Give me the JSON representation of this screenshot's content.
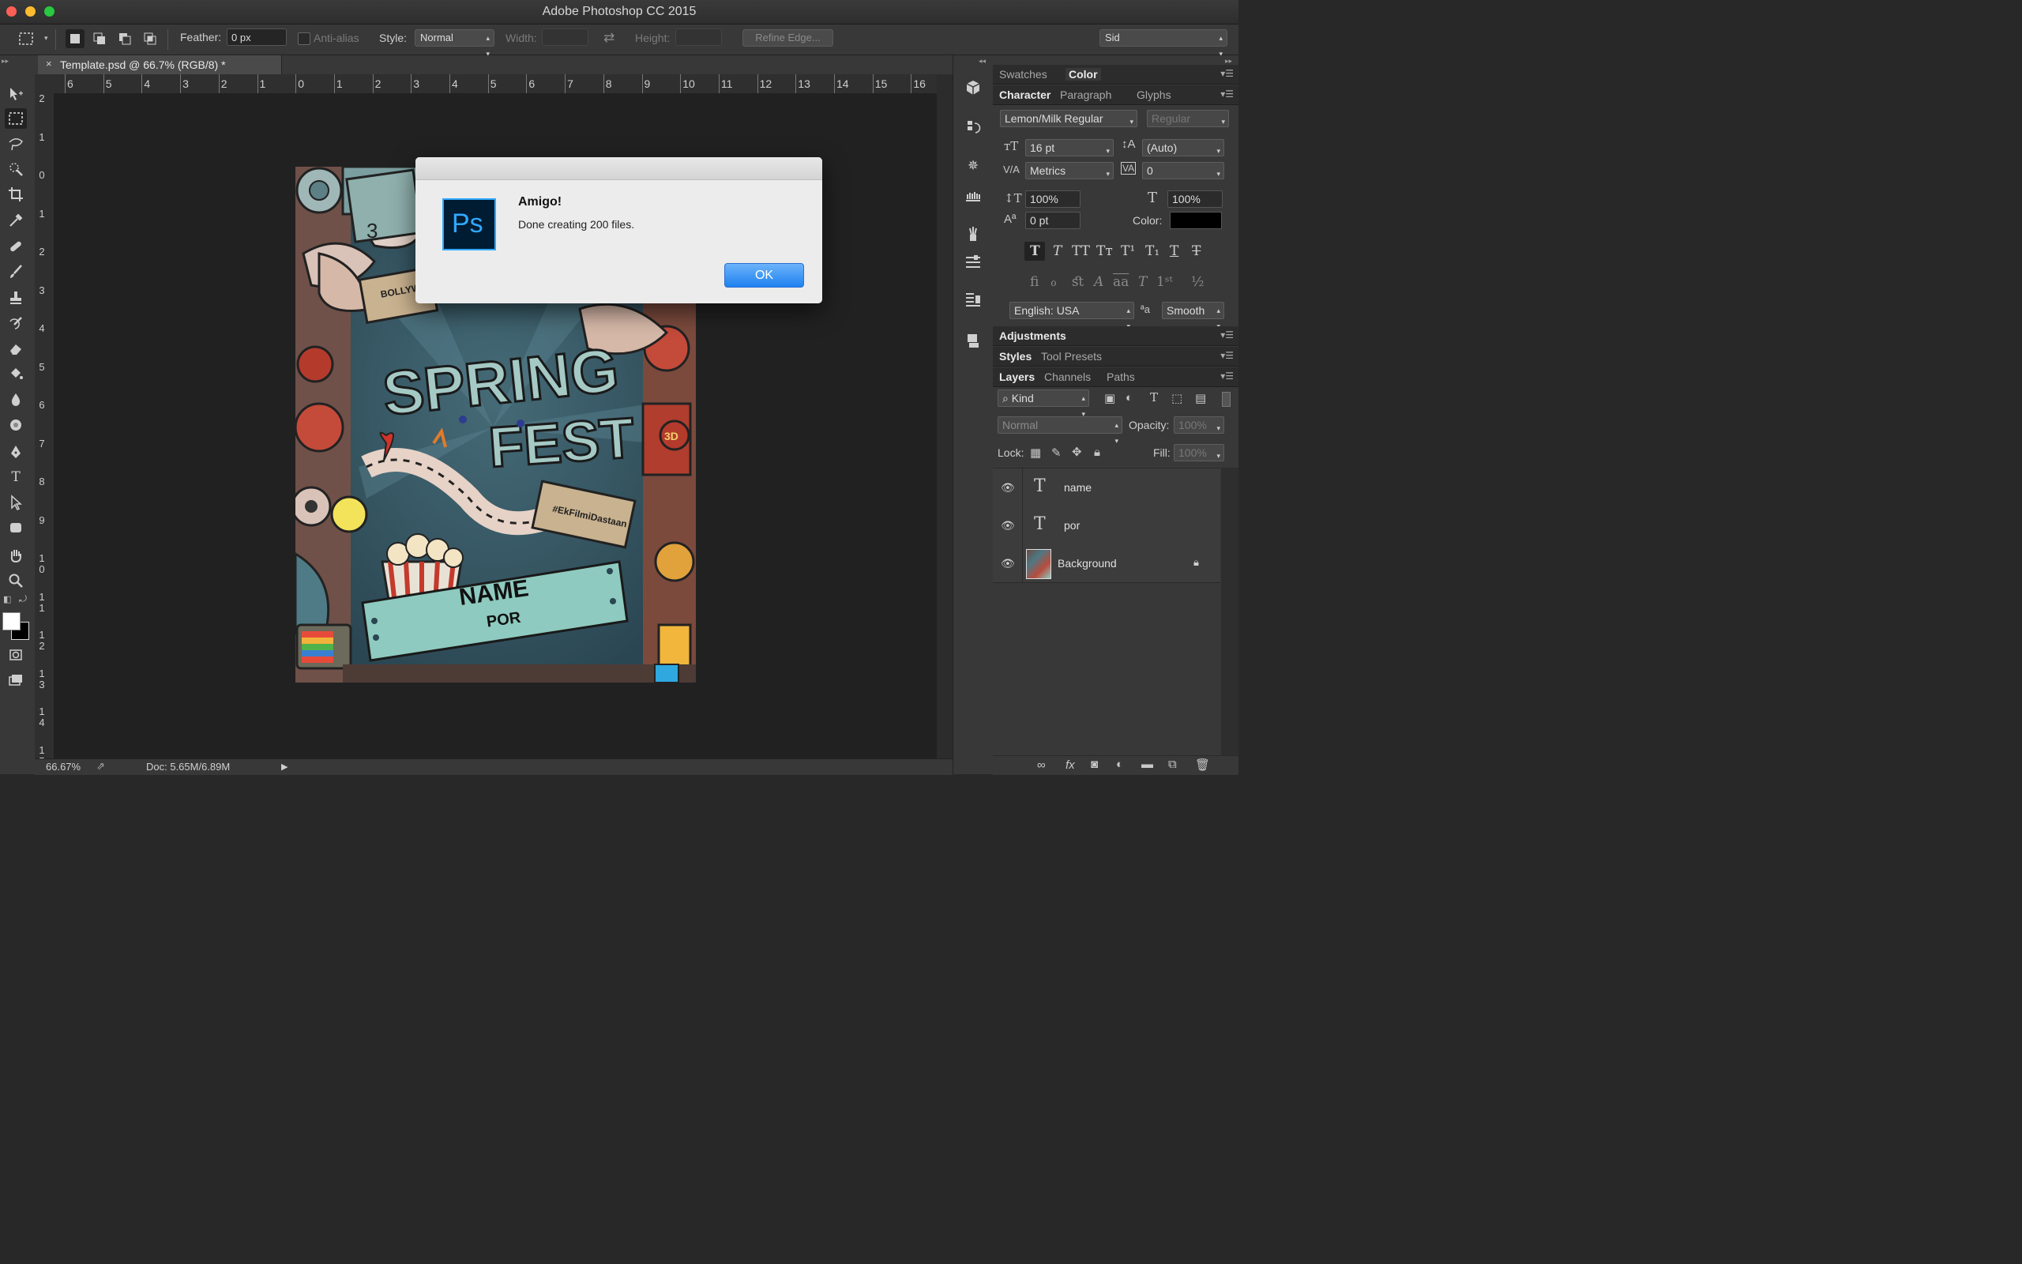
{
  "window": {
    "title": "Adobe Photoshop CC 2015"
  },
  "options": {
    "feather_label": "Feather:",
    "feather_value": "0 px",
    "antialias_label": "Anti-alias",
    "style_label": "Style:",
    "style_value": "Normal",
    "width_label": "Width:",
    "height_label": "Height:",
    "refine_edge": "Refine Edge...",
    "workspace": "Sid"
  },
  "document": {
    "tab_title": "Template.psd @ 66.7% (RGB/8) *",
    "zoom": "66.67%",
    "doc_size": "Doc: 5.65M/6.89M"
  },
  "rulers": {
    "horizontal": [
      "6",
      "5",
      "4",
      "3",
      "2",
      "1",
      "0",
      "1",
      "2",
      "3",
      "4",
      "5",
      "6",
      "7",
      "8",
      "9",
      "10",
      "11",
      "12",
      "13",
      "14",
      "15",
      "16"
    ],
    "vertical": [
      "2",
      "1",
      "0",
      "1",
      "2",
      "3",
      "4",
      "5",
      "6",
      "7",
      "8",
      "9",
      "10",
      "11",
      "12",
      "13",
      "14",
      "15"
    ]
  },
  "poster": {
    "title1": "SPRING",
    "title2": "FEST",
    "name_text": "NAME",
    "por_text": "POR",
    "ticket1": "BOLLYW BOULE",
    "ticket2": "#EkFilmiDastaan",
    "badge": "3D"
  },
  "dialog": {
    "app_icon_text": "Ps",
    "heading": "Amigo!",
    "message": "Done creating 200 files.",
    "ok_label": "OK"
  },
  "panels": {
    "color_tabs": [
      "Swatches",
      "Color"
    ],
    "char_tabs": [
      "Character",
      "Paragraph",
      "Glyphs"
    ],
    "font_family": "Lemon/Milk Regular",
    "font_style": "Regular",
    "font_size": "16 pt",
    "leading": "(Auto)",
    "kerning": "Metrics",
    "tracking": "0",
    "vertical_scale": "100%",
    "horizontal_scale": "100%",
    "baseline_shift": "0 pt",
    "color_label": "Color:",
    "text_color": "#000000",
    "language": "English: USA",
    "antialias": "Smooth",
    "adjustments_tab": "Adjustments",
    "styles_tabs": [
      "Styles",
      "Tool Presets"
    ],
    "layers_tabs": [
      "Layers",
      "Channels",
      "Paths"
    ],
    "filter_kind": "Kind",
    "blend_mode": "Normal",
    "opacity_label": "Opacity:",
    "opacity_value": "100%",
    "lock_label": "Lock:",
    "fill_label": "Fill:",
    "fill_value": "100%"
  },
  "layers": [
    {
      "name": "name",
      "type": "text"
    },
    {
      "name": "por",
      "type": "text"
    },
    {
      "name": "Background",
      "type": "image"
    }
  ]
}
